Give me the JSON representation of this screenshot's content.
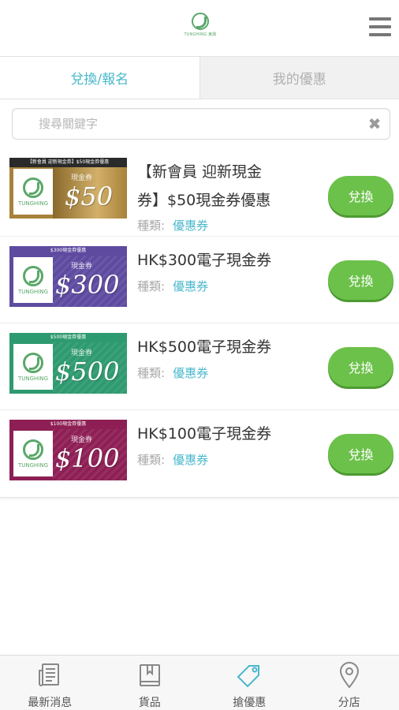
{
  "header": {
    "logo_text": "TUNGHING 東興",
    "menu_icon": "menu-icon"
  },
  "tabs": [
    {
      "label": "兌換/報名",
      "active": true
    },
    {
      "label": "我的優惠",
      "active": false
    }
  ],
  "search": {
    "placeholder": "搜尋關鍵字",
    "value": "",
    "clear_icon": "✖"
  },
  "category_label": "種類:",
  "redeem_label": "兌換",
  "items": [
    {
      "title_line1": "【新會員 迎新現金",
      "title_line2": "券】$50現金券優惠",
      "category": "優惠券",
      "voucher": {
        "header": "【新會員 迎新現金券】$50現金券優惠",
        "cash_label": "現金券",
        "amount": "$50",
        "logo": "TUNGHING",
        "color": "#a8823a"
      }
    },
    {
      "title_line1": "HK$300電子現金券",
      "category": "優惠券",
      "voucher": {
        "header": "$300現金券優惠",
        "cash_label": "現金券",
        "amount": "$300",
        "logo": "TUNGHING",
        "color": "#5e4ba0"
      }
    },
    {
      "title_line1": "HK$500電子現金券",
      "category": "優惠券",
      "voucher": {
        "header": "$500現金券優惠",
        "cash_label": "現金券",
        "amount": "$500",
        "logo": "TUNGHING",
        "color": "#2e9a70"
      }
    },
    {
      "title_line1": "HK$100電子現金券",
      "category": "優惠券",
      "voucher": {
        "header": "$100現金券優惠",
        "cash_label": "現金券",
        "amount": "$100",
        "logo": "TUNGHING",
        "color": "#8e1f55"
      }
    }
  ],
  "bottom_nav": [
    {
      "label": "最新消息",
      "icon": "newspaper-icon",
      "active": false
    },
    {
      "label": "貨品",
      "icon": "book-icon",
      "active": false
    },
    {
      "label": "搶優惠",
      "icon": "tag-icon",
      "active": true
    },
    {
      "label": "分店",
      "icon": "location-pin-icon",
      "active": false
    }
  ],
  "colors": {
    "accent": "#4ab8cc",
    "button": "#6cc14a",
    "logo_green": "#5aa869"
  }
}
